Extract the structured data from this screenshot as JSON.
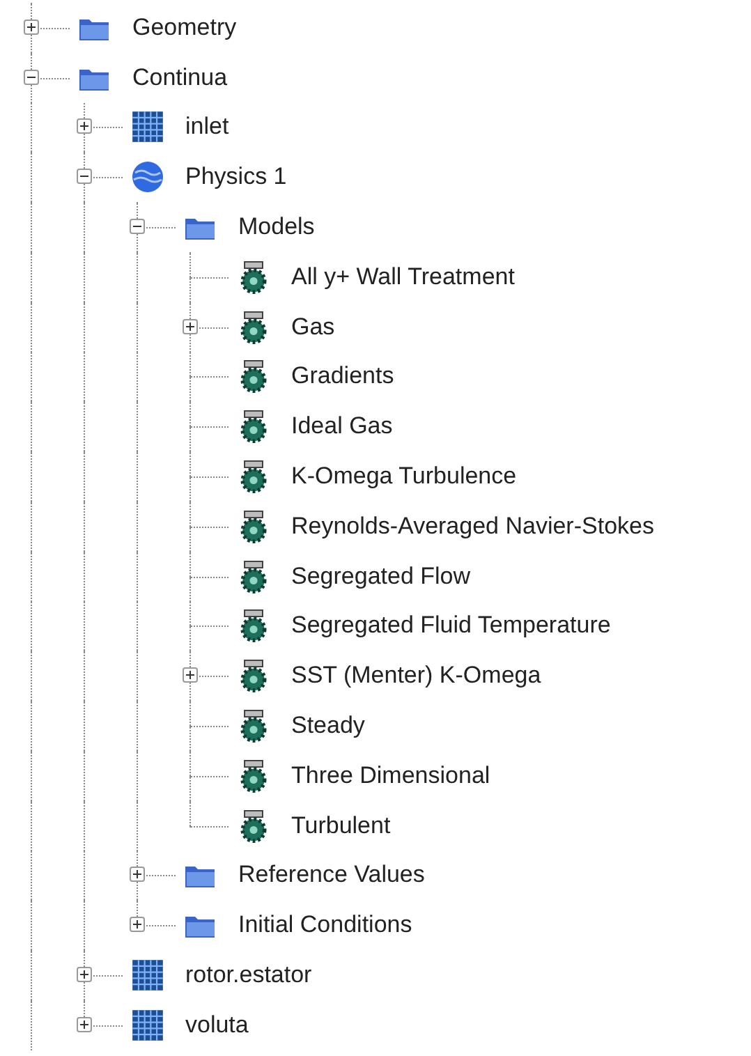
{
  "tree": [
    {
      "label": "Geometry",
      "kind": "folder",
      "expanded": false
    },
    {
      "label": "Continua",
      "kind": "folder",
      "expanded": true,
      "children": [
        {
          "label": "inlet",
          "kind": "region",
          "expanded": false
        },
        {
          "label": "Physics 1",
          "kind": "physics",
          "expanded": true,
          "children": [
            {
              "label": "Models",
              "kind": "folder",
              "expanded": true,
              "children": [
                {
                  "label": "All y+ Wall Treatment",
                  "kind": "model"
                },
                {
                  "label": "Gas",
                  "kind": "model",
                  "expanded": false
                },
                {
                  "label": "Gradients",
                  "kind": "model"
                },
                {
                  "label": "Ideal Gas",
                  "kind": "model"
                },
                {
                  "label": "K-Omega Turbulence",
                  "kind": "model"
                },
                {
                  "label": "Reynolds-Averaged Navier-Stokes",
                  "kind": "model"
                },
                {
                  "label": "Segregated Flow",
                  "kind": "model"
                },
                {
                  "label": "Segregated Fluid Temperature",
                  "kind": "model"
                },
                {
                  "label": "SST (Menter) K-Omega",
                  "kind": "model",
                  "expanded": false
                },
                {
                  "label": "Steady",
                  "kind": "model"
                },
                {
                  "label": "Three Dimensional",
                  "kind": "model"
                },
                {
                  "label": "Turbulent",
                  "kind": "model"
                }
              ]
            },
            {
              "label": "Reference Values",
              "kind": "folder",
              "expanded": false
            },
            {
              "label": "Initial Conditions",
              "kind": "folder",
              "expanded": false
            }
          ]
        },
        {
          "label": "rotor.estator",
          "kind": "region",
          "expanded": false
        },
        {
          "label": "voluta",
          "kind": "region",
          "expanded": false
        }
      ]
    }
  ]
}
